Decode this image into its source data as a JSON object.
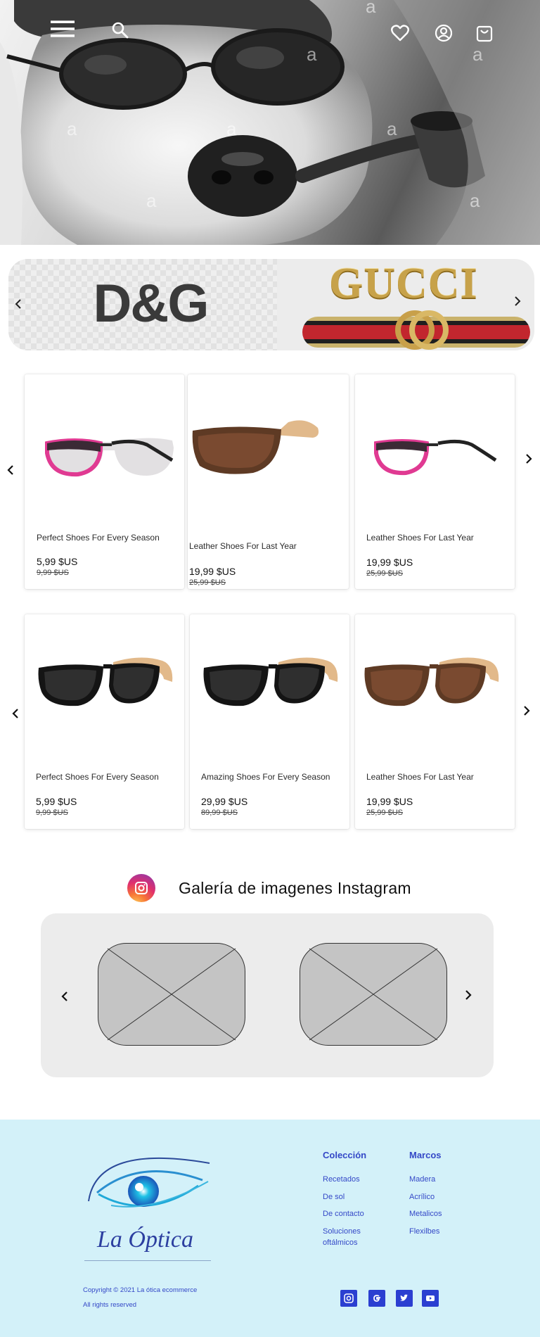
{
  "header": {
    "icons": [
      "menu-icon",
      "search-icon",
      "heart-icon",
      "user-icon",
      "cart-icon"
    ],
    "watermark": "a"
  },
  "brands": {
    "dg": "D&G",
    "gucci": "GUCCI"
  },
  "products_row1": [
    {
      "name": "Perfect Shoes For Every Season",
      "price": "5,99 $US",
      "old_price": "9,99 $US",
      "frame": "pink"
    },
    {
      "name": "Leather Shoes For Last Year",
      "price": "19,99 $US",
      "old_price": "25,99 $US",
      "frame": "brown"
    },
    {
      "name": "Leather Shoes For Last Year",
      "price": "19,99 $US",
      "old_price": "25,99 $US",
      "frame": "pink"
    }
  ],
  "products_row2": [
    {
      "name": "Perfect Shoes For Every Season",
      "price": "5,99 $US",
      "old_price": "9,99 $US",
      "frame": "black"
    },
    {
      "name": "Amazing Shoes For Every Season",
      "price": "29,99 $US",
      "old_price": "89,99 $US",
      "frame": "black"
    },
    {
      "name": "Leather Shoes For Last Year",
      "price": "19,99 $US",
      "old_price": "25,99 $US",
      "frame": "brown"
    }
  ],
  "instagram": {
    "title": "Galería de imagenes Instagram"
  },
  "footer": {
    "brand": "La Óptica",
    "col1": {
      "title": "Colección",
      "links": [
        "Recetados",
        "De sol",
        "De contacto",
        "Soluciones oftálmicos"
      ]
    },
    "col2": {
      "title": "Marcos",
      "links": [
        "Madera",
        "Acrílico",
        "Metalicos",
        "Flexilbes"
      ]
    },
    "copyright": "Copyright © 2021 La ótica ecommerce",
    "rights": "All rights reserved",
    "social": [
      "instagram-icon",
      "google-icon",
      "twitter-icon",
      "youtube-icon"
    ]
  },
  "colors": {
    "footer_bg": "#d3f1f9",
    "footer_text": "#3448c7",
    "card_bg": "#ffffff"
  }
}
